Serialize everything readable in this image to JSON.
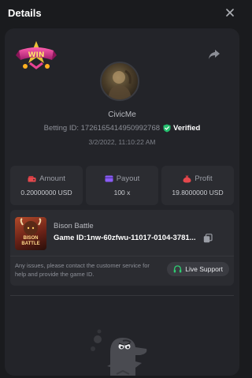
{
  "header": {
    "title": "Details"
  },
  "player": {
    "username": "CivicMe"
  },
  "bet": {
    "id_label": "Betting ID: 1726165414950992768",
    "verified_label": "Verified",
    "datetime": "3/2/2022, 11:10:22 AM"
  },
  "stats": [
    {
      "label": "Amount",
      "value": "0.20000000 USD",
      "icon": "wallet-icon"
    },
    {
      "label": "Payout",
      "value": "100 x",
      "icon": "card-icon"
    },
    {
      "label": "Profit",
      "value": "19.8000000 USD",
      "icon": "money-bag-icon"
    }
  ],
  "game": {
    "name": "Bison Battle",
    "id_text": "Game ID:1nw-60zfwu-11017-0104-3781...",
    "thumb_text": "BISON BATTLE"
  },
  "support": {
    "text": "Any issues, please contact the customer service for help and provide the game ID.",
    "button_label": "Live Support"
  },
  "logo": {
    "text": "WIN"
  },
  "colors": {
    "background": "#1a1b1e",
    "card": "#232429",
    "panel": "#2b2c31",
    "verified_green": "#25c16f",
    "stat_icon_red": "#e5484d",
    "stat_icon_purple": "#8b5cf6",
    "support_green": "#2ecc71"
  }
}
